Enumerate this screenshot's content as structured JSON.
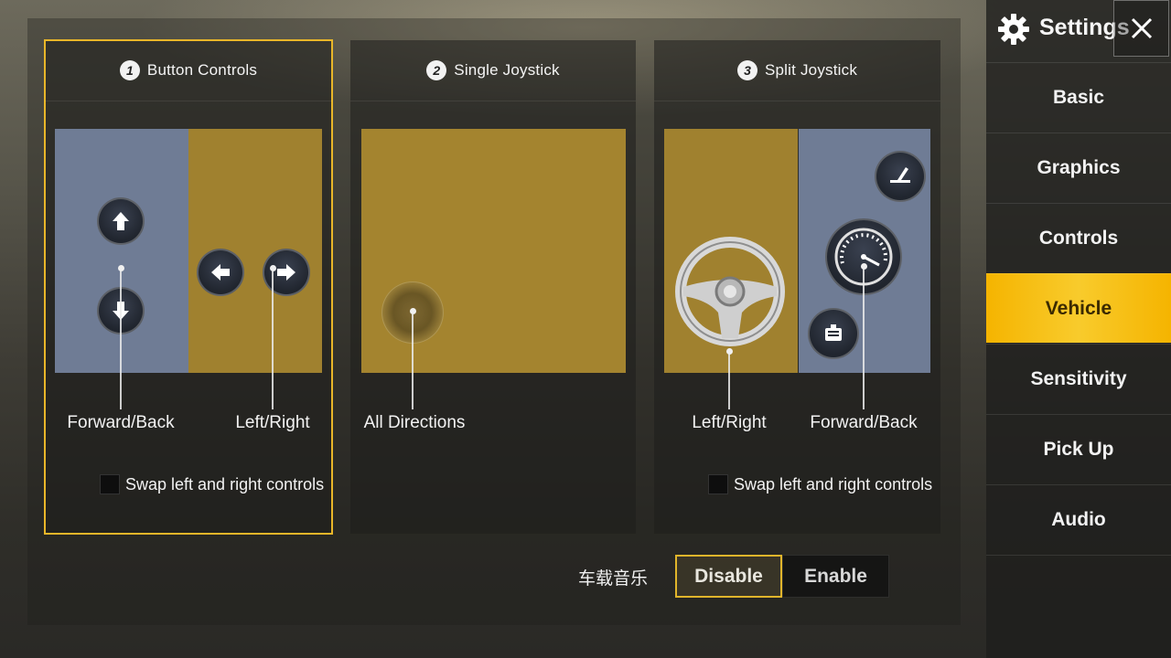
{
  "sidebar": {
    "title": "Settings",
    "close_icon": "close-x-icon",
    "items": [
      {
        "label": "Basic",
        "active": false
      },
      {
        "label": "Graphics",
        "active": false
      },
      {
        "label": "Controls",
        "active": false
      },
      {
        "label": "Vehicle",
        "active": true
      },
      {
        "label": "Sensitivity",
        "active": false
      },
      {
        "label": "Pick Up",
        "active": false
      },
      {
        "label": "Audio",
        "active": false
      }
    ]
  },
  "cards": [
    {
      "number": "1",
      "title": "Button Controls",
      "selected": true,
      "labels": [
        "Forward/Back",
        "Left/Right"
      ],
      "swap_label": "Swap left and right controls",
      "swap_checked": false
    },
    {
      "number": "2",
      "title": "Single Joystick",
      "selected": false,
      "labels": [
        "All Directions"
      ]
    },
    {
      "number": "3",
      "title": "Split Joystick",
      "selected": false,
      "labels": [
        "Left/Right",
        "Forward/Back"
      ],
      "swap_label": "Swap left and right controls",
      "swap_checked": false
    }
  ],
  "vehicle_music": {
    "label": "车载音乐",
    "options": [
      "Disable",
      "Enable"
    ],
    "selected": "Disable"
  },
  "colors": {
    "accent": "#f5b400",
    "zone_blue": "#6f7c95",
    "zone_gold": "#a0812f"
  }
}
